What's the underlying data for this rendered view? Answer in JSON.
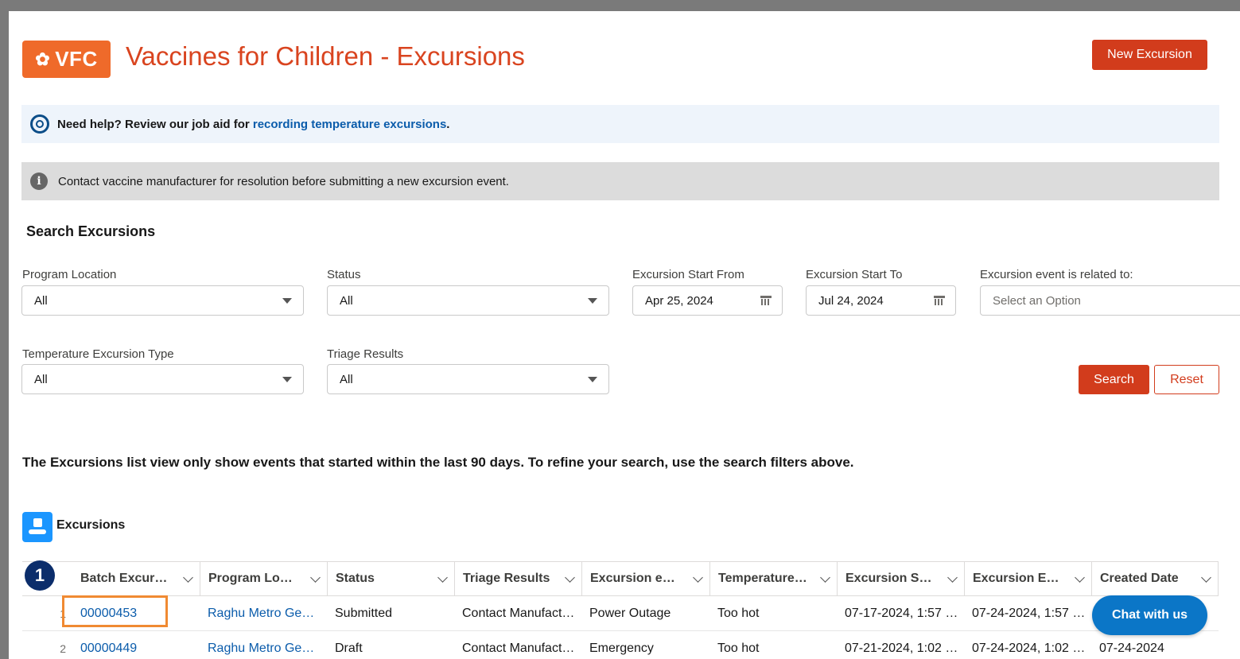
{
  "header": {
    "logo_text": "VFC",
    "title": "Vaccines for Children - Excursions",
    "new_button": "New Excursion"
  },
  "help_banner": {
    "prefix": "Need help? Review our job aid for ",
    "link": "recording temperature excursions",
    "suffix": "."
  },
  "info_banner": {
    "text": "Contact vaccine manufacturer for resolution before submitting a new excursion event."
  },
  "search": {
    "title": "Search Excursions",
    "program_location": {
      "label": "Program Location",
      "value": "All"
    },
    "status": {
      "label": "Status",
      "value": "All"
    },
    "start_from": {
      "label": "Excursion Start From",
      "value": "Apr 25, 2024"
    },
    "start_to": {
      "label": "Excursion Start To",
      "value": "Jul 24, 2024"
    },
    "related_to": {
      "label": "Excursion event is related to:",
      "placeholder": "Select an Option"
    },
    "temp_type": {
      "label": "Temperature Excursion Type",
      "value": "All"
    },
    "triage": {
      "label": "Triage Results",
      "value": "All"
    },
    "search_button": "Search",
    "reset_button": "Reset"
  },
  "notice": "The Excursions list view only show events that started within the last 90 days. To refine your search, use the search filters above.",
  "list": {
    "title": "Excursions",
    "columns": [
      "Batch Excur…",
      "Program Lo…",
      "Status",
      "Triage Results",
      "Excursion e…",
      "Temperature…",
      "Excursion S…",
      "Excursion E…",
      "Created Date"
    ],
    "rows": [
      {
        "num": "1",
        "batch": "00000453",
        "program": "Raghu Metro Ge…",
        "status": "Submitted",
        "triage": "Contact Manufact…",
        "event": "Power Outage",
        "temperature": "Too hot",
        "start": "07-17-2024, 1:57 …",
        "end": "07-24-2024, 1:57 …",
        "created": ""
      },
      {
        "num": "2",
        "batch": "00000449",
        "program": "Raghu Metro Ge…",
        "status": "Draft",
        "triage": "Contact Manufact…",
        "event": "Emergency",
        "temperature": "Too hot",
        "start": "07-21-2024, 1:02 …",
        "end": "07-24-2024, 1:02 …",
        "created": "07-24-2024"
      }
    ]
  },
  "step_badge": "1",
  "chat_button": "Chat with us"
}
